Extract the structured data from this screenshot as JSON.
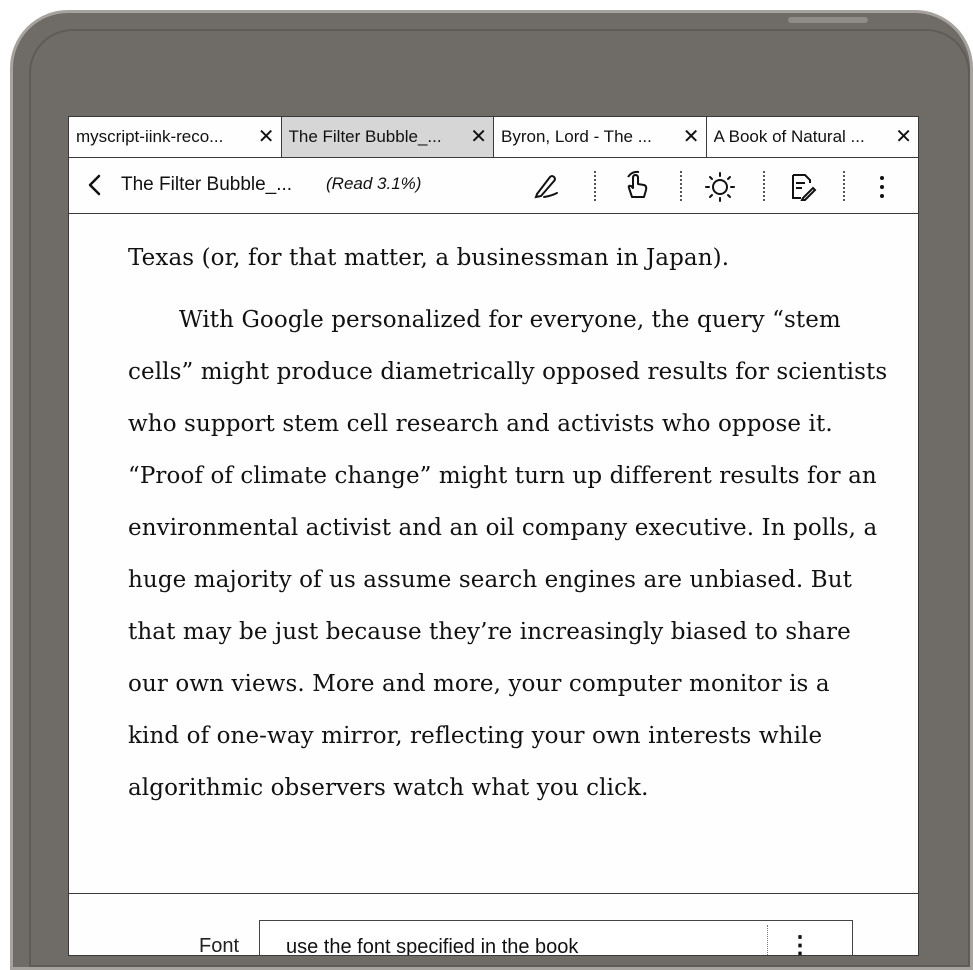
{
  "tabs": [
    {
      "label": "myscript-iink-reco...",
      "close": "✕",
      "active": false
    },
    {
      "label": "The Filter Bubble_...",
      "close": "✕",
      "active": true
    },
    {
      "label": "Byron, Lord - The ...",
      "close": "✕",
      "active": false
    },
    {
      "label": "A Book of Natural ...",
      "close": "✕",
      "active": false
    }
  ],
  "toolbar": {
    "back_icon": "chevron-left-icon",
    "book_title": "The Filter Bubble_...",
    "read_progress": "(Read 3.1%)",
    "tools": [
      "pen-icon",
      "touch-hand-icon",
      "brightness-icon",
      "notes-icon",
      "more-vert-icon"
    ]
  },
  "content": {
    "paragraphs": [
      "Texas (or, for that matter, a businessman in Japan).",
      "With Google personalized for everyone, the query “stem cells” might produce diametrically opposed results for scientists who support stem cell research and activists who oppose it. “Proof of climate change” might turn up different results for an environmental activist and an oil company executive. In polls, a huge majority of us assume search engines are unbiased. But that may be just because they’re increasingly biased to share our own views. More and more, your computer monitor is a kind of one-way mirror, reflecting your own interests while algorithmic observers watch what you click."
    ]
  },
  "font_setting": {
    "label": "Font",
    "value": "use the font specified in the book",
    "more": "⋮"
  },
  "colors": {
    "device_frame": "#6f6b67",
    "active_tab": "#d6d6d6",
    "screen": "#fefefe"
  }
}
